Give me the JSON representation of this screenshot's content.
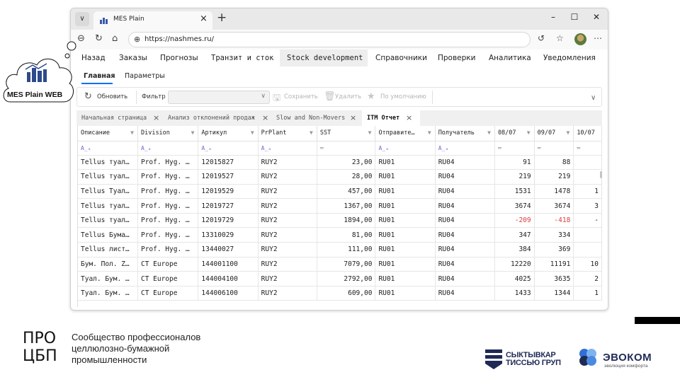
{
  "browser": {
    "tab_title": "MES Plain",
    "url": "https://nashmes.ru/"
  },
  "menu": [
    "Назад",
    "Заказы",
    "Прогнозы",
    "Транзит и сток",
    "Stock development",
    "Справочники",
    "Проверки",
    "Аналитика",
    "Уведомления"
  ],
  "subtabs": [
    "Главная",
    "Параметры"
  ],
  "toolbar": {
    "refresh": "Обновить",
    "filter": "Фильтр",
    "save": "Сохранить",
    "delete": "Удалить",
    "default": "По умолчанию"
  },
  "doc_tabs": [
    "Начальная страница",
    "Анализ отклонений продаж",
    "Slow and Non-Movers",
    "ITM Отчет"
  ],
  "grid": {
    "columns": [
      "Описание",
      "Division",
      "Артикул",
      "PrPlant",
      "SST",
      "Отправите…",
      "Получатель",
      "08/07",
      "09/07",
      "10/07"
    ],
    "rows": [
      [
        "Tellus туал…",
        "Prof. Hyg. …",
        "12015827",
        "RUY2",
        "23,00",
        "RU01",
        "RU04",
        "91",
        "88",
        ""
      ],
      [
        "Tellus туал…",
        "Prof. Hyg. …",
        "12019527",
        "RUY2",
        "28,00",
        "RU01",
        "RU04",
        "219",
        "219",
        ""
      ],
      [
        "Tellus Туал…",
        "Prof. Hyg. …",
        "12019529",
        "RUY2",
        "457,00",
        "RU01",
        "RU04",
        "1531",
        "1478",
        "1"
      ],
      [
        "Tellus туал…",
        "Prof. Hyg. …",
        "12019727",
        "RUY2",
        "1367,00",
        "RU01",
        "RU04",
        "3674",
        "3674",
        "3"
      ],
      [
        "Tellus туал…",
        "Prof. Hyg. …",
        "12019729",
        "RUY2",
        "1894,00",
        "RU01",
        "RU04",
        "-209",
        "-418",
        "-"
      ],
      [
        "Tellus Бума…",
        "Prof. Hyg. …",
        "13310029",
        "RUY2",
        "81,00",
        "RU01",
        "RU04",
        "347",
        "334",
        ""
      ],
      [
        "Tellus лист…",
        "Prof. Hyg. …",
        "13440027",
        "RUY2",
        "111,00",
        "RU01",
        "RU04",
        "384",
        "369",
        ""
      ],
      [
        "Бум. Пол. Z…",
        "CT Europe",
        "144001100",
        "RUY2",
        "7079,00",
        "RU01",
        "RU04",
        "12220",
        "11191",
        "10"
      ],
      [
        "Туал. Бум. …",
        "CT Europe",
        "144004100",
        "RUY2",
        "2792,00",
        "RU01",
        "RU04",
        "4025",
        "3635",
        "2"
      ],
      [
        "Туал. Бум. …",
        "CT Europe",
        "144006100",
        "RUY2",
        "609,00",
        "RU01",
        "RU04",
        "1433",
        "1344",
        "1"
      ]
    ]
  },
  "cloud_logo": "MES Plain WEB",
  "footer": {
    "pro_line1": "ПРО",
    "pro_line2": "ЦБП",
    "pro_desc": [
      "Сообщество профессионалов",
      "целлюлозно-бумажной",
      "промышленности"
    ],
    "skt": [
      "СЫКТЫВКАР",
      "ТИССЬЮ ГРУП"
    ],
    "evo_name": "ЭВОКОМ",
    "evo_sub": "эволюция комфорта"
  },
  "colors": {
    "accent": "#0d6efd",
    "negative": "#e03c3c",
    "brand": "#1f2a55"
  }
}
